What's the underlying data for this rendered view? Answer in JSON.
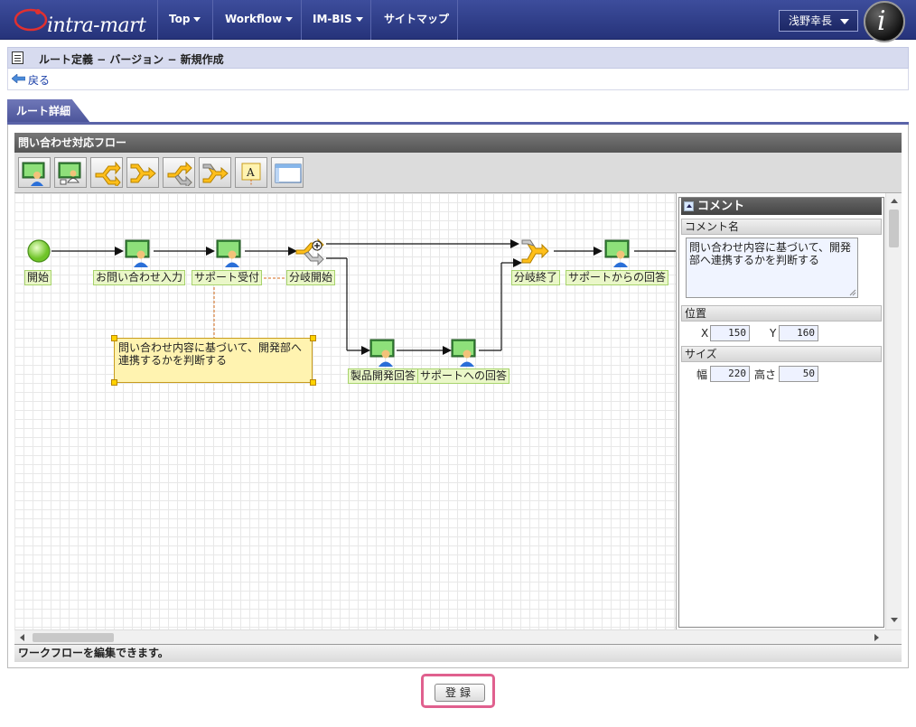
{
  "header": {
    "logo_text": "intra-mart",
    "nav": [
      {
        "label": "Top"
      },
      {
        "label": "Workflow"
      },
      {
        "label": "IM-BIS"
      },
      {
        "label": "サイトマップ"
      }
    ],
    "user_name": "浅野幸長"
  },
  "page": {
    "title": "ルート定義 − バージョン − 新規作成",
    "back_label": "戻る",
    "tab_label": "ルート詳細"
  },
  "editor": {
    "flow_title": "問い合わせ対応フロー",
    "toolbar_icons": [
      "user-task-icon",
      "user-task-alt-icon",
      "branch-start-icon",
      "branch-end-icon",
      "branch-start-gray-icon",
      "branch-end-gray-icon",
      "annotation-icon",
      "panel-icon"
    ],
    "nodes": [
      {
        "id": "start",
        "label": "開始"
      },
      {
        "id": "inquiry_input",
        "label": "お問い合わせ入力"
      },
      {
        "id": "support_accept",
        "label": "サポート受付"
      },
      {
        "id": "branch_start",
        "label": "分岐開始"
      },
      {
        "id": "product_dev_answer",
        "label": "製品開発回答"
      },
      {
        "id": "answer_to_support",
        "label": "サポートへの回答"
      },
      {
        "id": "branch_end",
        "label": "分岐終了"
      },
      {
        "id": "answer_from_support",
        "label": "サポートからの回答"
      }
    ],
    "comment_text": "問い合わせ内容に基づいて、開発部へ連携するかを判断する",
    "status_text": "ワークフローを編集できます。"
  },
  "properties": {
    "header": "コメント",
    "comment_name_label": "コメント名",
    "comment_name_value": "問い合わせ内容に基づいて、開発部へ連携するかを判断する",
    "position_label": "位置",
    "x_label": "X",
    "x_value": "150",
    "y_label": "Y",
    "y_value": "160",
    "size_label": "サイズ",
    "width_label": "幅",
    "width_value": "220",
    "height_label": "高さ",
    "height_value": "50"
  },
  "footer": {
    "save_label": "登録"
  },
  "colors": {
    "header_bg": "#2f3d8a",
    "tab_bg": "#5a63a8",
    "node_label_bg": "#eaf7c8",
    "comment_bg": "#fff3b0",
    "highlight_border": "#e0608e"
  }
}
